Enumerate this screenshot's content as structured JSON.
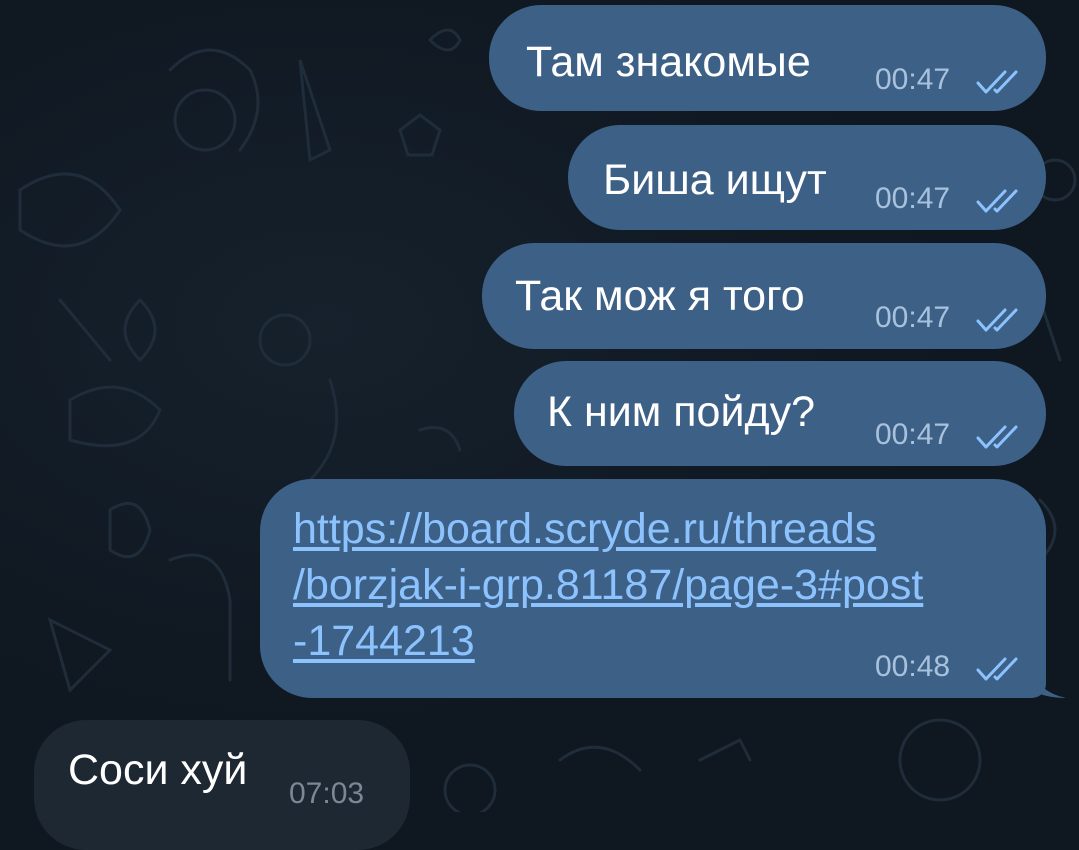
{
  "chat": {
    "messages": [
      {
        "direction": "out",
        "text": "Там знакомые",
        "time": "00:47",
        "status": "read"
      },
      {
        "direction": "out",
        "text": "Биша ищут",
        "time": "00:47",
        "status": "read"
      },
      {
        "direction": "out",
        "text": "Так мож я того",
        "time": "00:47",
        "status": "read"
      },
      {
        "direction": "out",
        "text": "К ним пойду?",
        "time": "00:47",
        "status": "read"
      },
      {
        "direction": "out",
        "link_lines": [
          "https://board.scryde.ru/threads",
          "/borzjak-i-grp.81187/page-3#post",
          "-1744213"
        ],
        "time": "00:48",
        "status": "read"
      },
      {
        "direction": "in",
        "text": "Соси хуй",
        "time": "07:03"
      }
    ]
  },
  "colors": {
    "background": "#0f1720",
    "outgoing_bubble": "#3d6087",
    "incoming_bubble": "#1e2833",
    "link": "#8cc3ff",
    "read_ticks": "#8cc3ff"
  },
  "icons": {
    "read_status": "double-check-icon",
    "wallpaper": "doodle-pattern"
  }
}
